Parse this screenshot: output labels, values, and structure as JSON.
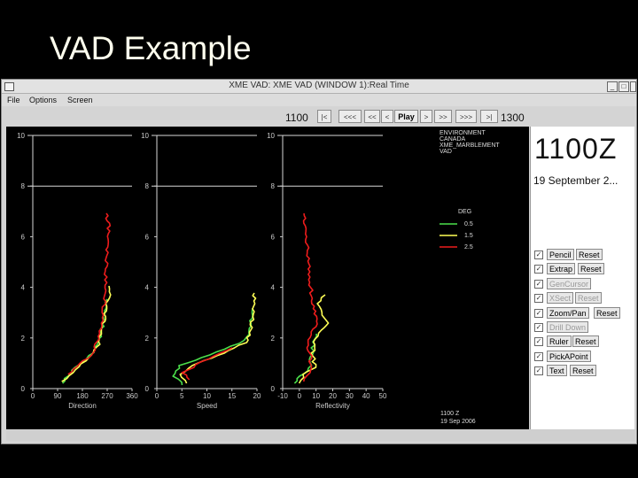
{
  "slide_title": "VAD Example",
  "window": {
    "title": "XME VAD: XME VAD (WINDOW 1):Real Time",
    "menus": [
      "File",
      "Options",
      "Screen"
    ]
  },
  "toolbar": {
    "start_time": "1100",
    "end_time": "1300",
    "buttons": [
      "|<",
      "<<<",
      "<<",
      "<",
      "Play",
      ">",
      ">>",
      ">>>",
      ">|"
    ]
  },
  "plot": {
    "info_lines": [
      "ENVIRONMENT",
      "CANADA",
      "XME_MARBLEMENT",
      "VAD"
    ],
    "legend": {
      "title": "DEG",
      "entries": [
        {
          "label": "0.5",
          "color": "#4be04b"
        },
        {
          "label": "1.5",
          "color": "#ffff55"
        },
        {
          "label": "2.5",
          "color": "#ee1c1c"
        }
      ]
    },
    "footer_time": "1100 Z",
    "footer_date": "19 Sep 2006",
    "panels": [
      {
        "xlabel": "Direction",
        "xticks": [
          "0",
          "90",
          "180",
          "270",
          "360"
        ],
        "yticks": [
          "0",
          "2",
          "4",
          "6",
          "8",
          "10"
        ]
      },
      {
        "xlabel": "Speed",
        "xticks": [
          "0",
          "5",
          "10",
          "15",
          "20"
        ],
        "yticks": [
          "0",
          "2",
          "4",
          "6",
          "8",
          "10"
        ]
      },
      {
        "xlabel": "Reflectivity",
        "xticks": [
          "-10",
          "0",
          "10",
          "20",
          "30",
          "40",
          "50"
        ],
        "yticks": [
          "0",
          "2",
          "4",
          "6",
          "8",
          "10"
        ]
      }
    ]
  },
  "side": {
    "clock": "1100Z",
    "date": "19 September 2...",
    "controls": [
      {
        "name": "Pencil",
        "reset": "Reset",
        "checked": true,
        "enabled": true
      },
      {
        "name": "Extrap",
        "reset": "Reset",
        "checked": true,
        "enabled": true
      },
      {
        "name": "GenCursor",
        "reset": "",
        "checked": true,
        "enabled": false
      },
      {
        "name": "XSect",
        "reset": "Reset",
        "checked": true,
        "enabled": false
      },
      {
        "name": "Zoom/Pan",
        "reset": "Reset",
        "checked": true,
        "enabled": true
      },
      {
        "name": "Drill Down",
        "reset": "",
        "checked": true,
        "enabled": false
      },
      {
        "name": "Ruler",
        "reset": "Reset",
        "checked": true,
        "enabled": true
      },
      {
        "name": "PickAPoint",
        "reset": "",
        "checked": true,
        "enabled": true
      },
      {
        "name": "Text",
        "reset": "Reset",
        "checked": true,
        "enabled": true
      }
    ]
  }
}
